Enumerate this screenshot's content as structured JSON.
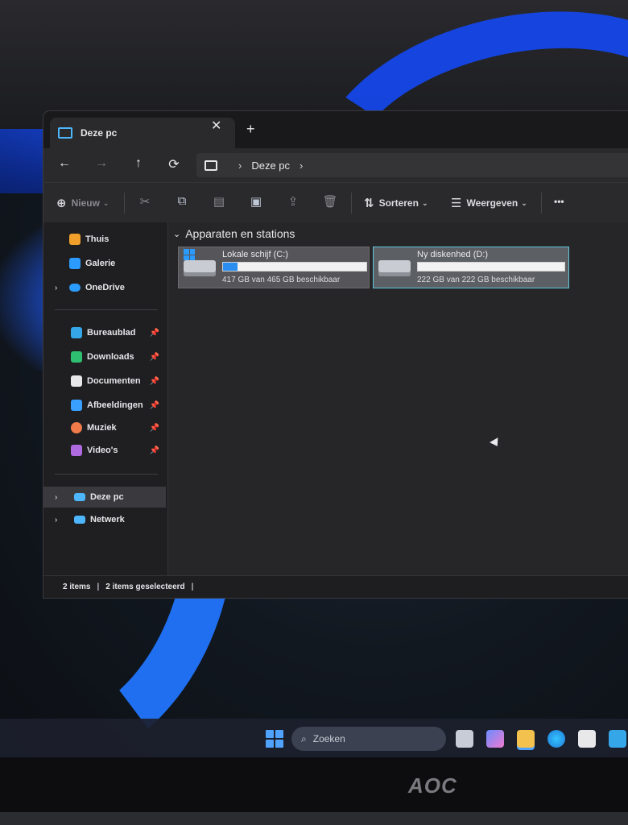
{
  "window": {
    "tab_title": "Deze pc",
    "tab_close": "✕",
    "new_tab": "+"
  },
  "nav": {
    "back": "←",
    "forward": "→",
    "up": "↑",
    "refresh": "⟳",
    "breadcrumb": [
      "Deze pc"
    ]
  },
  "toolbar": {
    "new_label": "Nieuw",
    "sort_label": "Sorteren",
    "view_label": "Weergeven",
    "more_label": "•••",
    "icons": [
      "cut-icon",
      "copy-icon",
      "paste-icon",
      "rename-icon",
      "share-icon",
      "delete-icon"
    ]
  },
  "sidebar": {
    "top": [
      {
        "label": "Thuis",
        "icon": "home-icon",
        "color": "#f0a02a"
      },
      {
        "label": "Galerie",
        "icon": "gallery-icon",
        "color": "#2b9bff"
      },
      {
        "label": "OneDrive",
        "icon": "onedrive-icon",
        "color": "#2b9bff",
        "expandable": true
      }
    ],
    "quick": [
      {
        "label": "Bureaublad",
        "icon": "desktop-icon",
        "color": "#35a7e8"
      },
      {
        "label": "Downloads",
        "icon": "downloads-icon",
        "color": "#2fbf71"
      },
      {
        "label": "Documenten",
        "icon": "documents-icon",
        "color": "#e8e8ea"
      },
      {
        "label": "Afbeeldingen",
        "icon": "pictures-icon",
        "color": "#3aa0ff"
      },
      {
        "label": "Muziek",
        "icon": "music-icon",
        "color": "#f07a4a"
      },
      {
        "label": "Video's",
        "icon": "videos-icon",
        "color": "#b06ae0"
      }
    ],
    "bottom": [
      {
        "label": "Deze pc",
        "icon": "this-pc-icon",
        "color": "#4db6ff",
        "selected": true
      },
      {
        "label": "Netwerk",
        "icon": "network-icon",
        "color": "#4db6ff"
      }
    ]
  },
  "content": {
    "group_title": "Apparaten en stations",
    "drives": [
      {
        "name": "Lokale schijf (C:)",
        "info": "417 GB van 465 GB beschikbaar",
        "used_fraction": 0.1
      },
      {
        "name": "Ny diskenhed (D:)",
        "info": "222 GB van 222 GB beschikbaar",
        "used_fraction": 0.0
      }
    ]
  },
  "status": {
    "items": "2 items",
    "selected": "2 items geselecteerd"
  },
  "taskbar": {
    "search_placeholder": "Zoeken"
  },
  "monitor": {
    "brand": "AOC"
  },
  "colors": {
    "accent": "#2a8df0",
    "selection_border": "#5fc7e0"
  }
}
